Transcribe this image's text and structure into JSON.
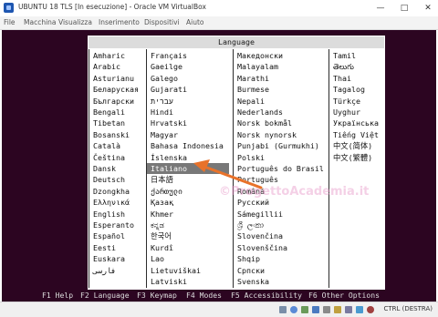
{
  "window": {
    "title": "UBUNTU 18 TLS [In esecuzione] - Oracle VM VirtualBox",
    "minimize_icon": "minimize-icon",
    "maximize_icon": "maximize-icon",
    "close_icon": "close-icon"
  },
  "menubar": [
    "File",
    "Macchina",
    "Visualizza",
    "Inserimento",
    "Dispositivi",
    "Aiuto"
  ],
  "dialog": {
    "title": "Language",
    "columns": [
      [
        "Amharic",
        "Arabic",
        "Asturianu",
        "Беларуская",
        "Български",
        "Bengali",
        "Tibetan",
        "Bosanski",
        "Català",
        "Čeština",
        "Dansk",
        "Deutsch",
        "Dzongkha",
        "Ελληνικά",
        "English",
        "Esperanto",
        "Español",
        "Eesti",
        "Euskara",
        "فارسی"
      ],
      [
        "Français",
        "Gaeilge",
        "Galego",
        "Gujarati",
        "עברית",
        "Hindi",
        "Hrvatski",
        "Magyar",
        "Bahasa Indonesia",
        "Íslenska",
        "Italiano",
        "日本語",
        "ქართული",
        "Қазақ",
        "Khmer",
        "ಕನ್ನಡ",
        "한국어",
        "Kurdî",
        "Lao",
        "Lietuviškai",
        "Latviski"
      ],
      [
        "Македонски",
        "Malayalam",
        "Marathi",
        "Burmese",
        "Nepali",
        "Nederlands",
        "Norsk bokmål",
        "Norsk nynorsk",
        "Punjabi (Gurmukhi)",
        "Polski",
        "Português do Brasil",
        "Português",
        "Română",
        "Русский",
        "Sámegillii",
        "ශ්‍රී ලංකා",
        "Slovenčina",
        "Slovenščina",
        "Shqip",
        "Српски",
        "Svenska"
      ],
      [
        "Tamil",
        "తెలుగు",
        "Thai",
        "Tagalog",
        "Türkçe",
        "Uyghur",
        "Українська",
        "Tiếng Việt",
        "中文(简体)",
        "中文(繁體)"
      ]
    ],
    "selected": "Italiano"
  },
  "function_keys": [
    "F1 Help",
    "F2 Language",
    "F3 Keymap",
    "F4 Modes",
    "F5 Accessibility",
    "F6 Other Options"
  ],
  "watermark": "©ProgettoAcademia.it",
  "statusbar": {
    "host_key": "CTRL (DESTRA)"
  },
  "colors": {
    "vm_background": "#2c0521",
    "selection": "#787878",
    "arrow": "#e8722a"
  }
}
